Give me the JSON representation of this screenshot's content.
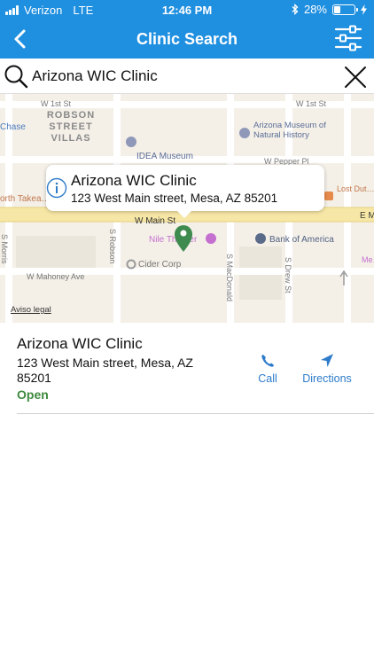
{
  "status_bar": {
    "carrier": "Verizon",
    "network": "LTE",
    "time": "12:46 PM",
    "battery": "28%",
    "battery_level": 0.28
  },
  "nav": {
    "title": "Clinic Search",
    "back_icon": "chevron-left-icon",
    "filter_icon": "sliders-icon"
  },
  "search": {
    "value": "Arizona WIC Clinic",
    "icon": "search-icon",
    "clear_icon": "close-icon"
  },
  "map": {
    "labels": {
      "w1st_a": "W 1st St",
      "w1st_b": "W 1st St",
      "robson_villas": "ROBSON STREET VILLAS",
      "chase": "Chase",
      "museum": "Arizona Museum of Natural History",
      "idea": "IDEA Museum",
      "w_pepper": "W Pepper Pl",
      "lost_dutch": "Lost Dut… Coffee H…",
      "north_takeaway": "orth Takea…",
      "w_main": "W Main St",
      "e_main": "E M…",
      "nile": "Nile Theater",
      "bank": "Bank of America",
      "cider": "Cider Corp",
      "s_morris": "S Morris",
      "s_robson": "S Robson",
      "s_macdonald": "S MacDonald",
      "s_drew": "S Drew St",
      "w_mahoney": "W Mahoney Ave",
      "me": "Me…"
    },
    "legal": "Aviso legal",
    "callout": {
      "title": "Arizona WIC Clinic",
      "address": "123 West Main street, Mesa, AZ 85201",
      "info_icon": "info-icon"
    },
    "pin_icon": "map-pin-icon"
  },
  "result": {
    "name": "Arizona WIC Clinic",
    "address": "123 West Main street, Mesa, AZ 85201",
    "status": "Open",
    "call_label": "Call",
    "directions_label": "Directions"
  },
  "colors": {
    "header": "#1f8fe0",
    "action": "#2d7bc9",
    "open": "#3f8a3f",
    "pin": "#3f8a4e"
  }
}
